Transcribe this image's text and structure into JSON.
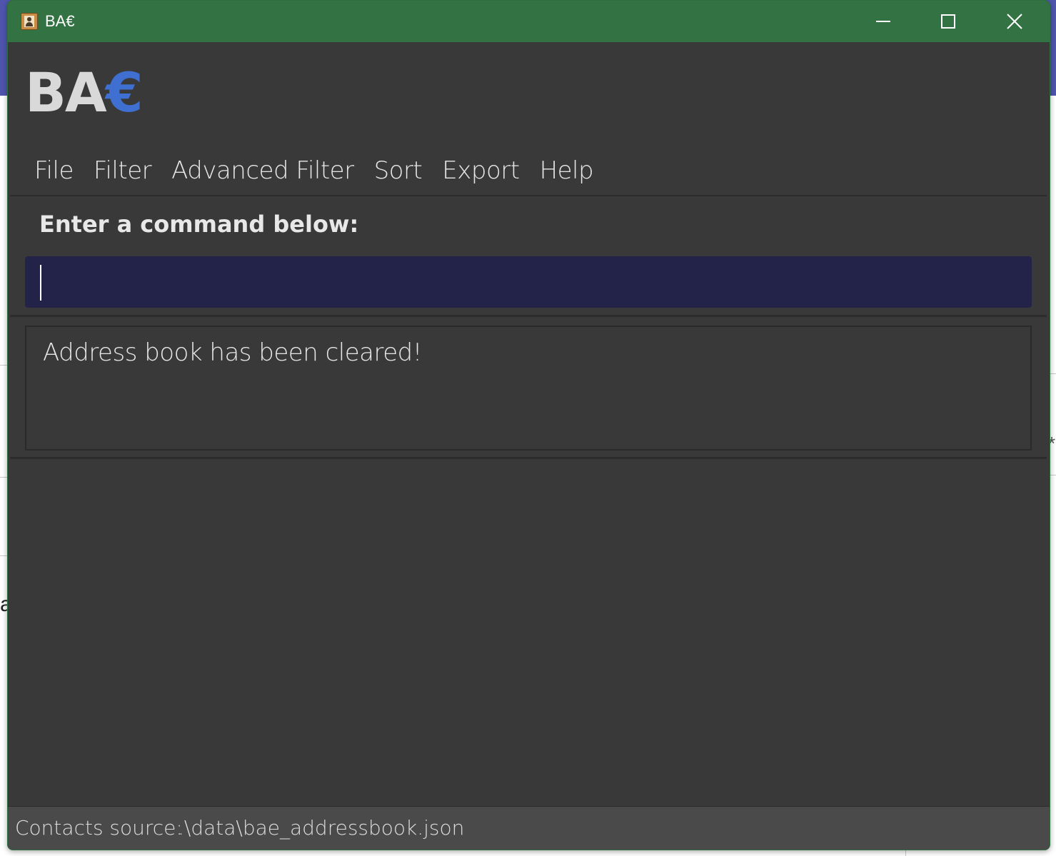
{
  "window": {
    "title": "BA€",
    "icon": "address-book-icon",
    "controls": {
      "minimize_icon": "minimize-icon",
      "maximize_icon": "maximize-icon",
      "close_icon": "close-icon"
    }
  },
  "logo": {
    "main": "BA",
    "accent": "€"
  },
  "menu": {
    "items": [
      {
        "label": "File"
      },
      {
        "label": "Filter"
      },
      {
        "label": "Advanced Filter"
      },
      {
        "label": "Sort"
      },
      {
        "label": "Export"
      },
      {
        "label": "Help"
      }
    ]
  },
  "command": {
    "label": "Enter a command below:",
    "value": ""
  },
  "result": {
    "message": "Address book has been cleared!"
  },
  "status": {
    "label": "Contacts source:",
    "value": ".\\data\\bae_addressbook.json"
  },
  "background": {
    "glyph_left": "a",
    "glyph_right": "*"
  },
  "colors": {
    "titlebar": "#337242",
    "window_bg": "#393939",
    "input_bg": "#23234a",
    "logo_accent": "#3f6fd0",
    "statusbar": "#4a4a4a"
  }
}
